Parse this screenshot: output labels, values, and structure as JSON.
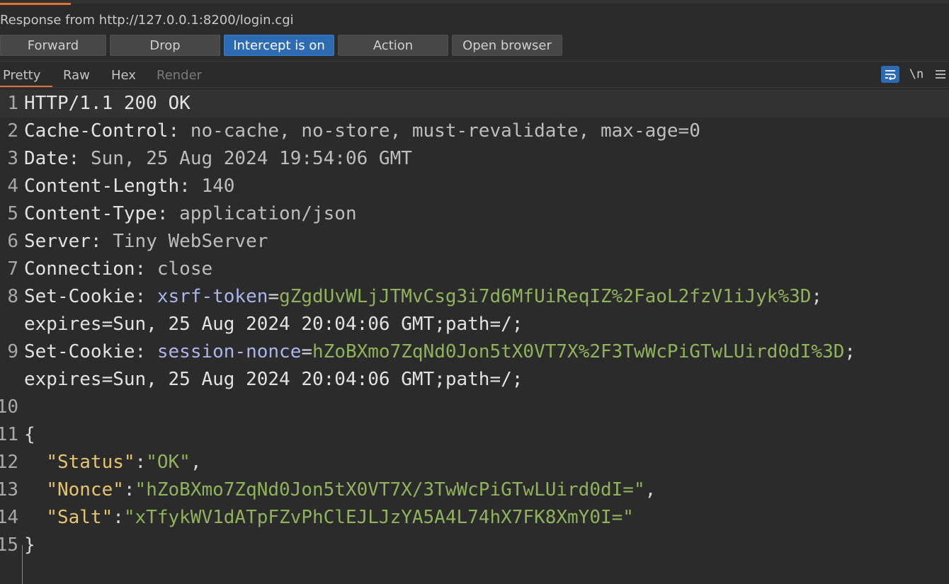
{
  "window": {
    "title": "Response from http://127.0.0.1:8200/login.cgi"
  },
  "toolbar": {
    "buttons": [
      {
        "label": "Forward",
        "active": false
      },
      {
        "label": "Drop",
        "active": false
      },
      {
        "label": "Intercept is on",
        "active": true
      },
      {
        "label": "Action",
        "active": false
      },
      {
        "label": "Open browser",
        "active": false
      }
    ]
  },
  "viewer": {
    "tabs": [
      {
        "label": "Pretty",
        "selected": true,
        "enabled": true
      },
      {
        "label": "Raw",
        "selected": false,
        "enabled": true
      },
      {
        "label": "Hex",
        "selected": false,
        "enabled": true
      },
      {
        "label": "Render",
        "selected": false,
        "enabled": false
      }
    ],
    "tools": {
      "wrap_icon": "wrap-lines-icon",
      "newline_label": "\\n",
      "menu_icon": "hamburger-menu-icon"
    }
  },
  "response": {
    "lines": [
      {
        "num": "1",
        "parts": [
          {
            "t": "HTTP/1.1 200 OK",
            "c": "hname"
          }
        ]
      },
      {
        "num": "2",
        "parts": [
          {
            "t": "Cache-Control",
            "c": "hname"
          },
          {
            "t": ": ",
            "c": "punct"
          },
          {
            "t": "no-cache, no-store, must-revalidate, max-age=0",
            "c": "hval"
          }
        ]
      },
      {
        "num": "3",
        "parts": [
          {
            "t": "Date",
            "c": "hname"
          },
          {
            "t": ": ",
            "c": "punct"
          },
          {
            "t": "Sun, 25 Aug 2024 19:54:06 GMT",
            "c": "hval"
          }
        ]
      },
      {
        "num": "4",
        "parts": [
          {
            "t": "Content-Length",
            "c": "hname"
          },
          {
            "t": ": ",
            "c": "punct"
          },
          {
            "t": "140",
            "c": "hval"
          }
        ]
      },
      {
        "num": "5",
        "parts": [
          {
            "t": "Content-Type",
            "c": "hname"
          },
          {
            "t": ": ",
            "c": "punct"
          },
          {
            "t": "application/json",
            "c": "hval"
          }
        ]
      },
      {
        "num": "6",
        "parts": [
          {
            "t": "Server",
            "c": "hname"
          },
          {
            "t": ": ",
            "c": "punct"
          },
          {
            "t": "Tiny WebServer",
            "c": "hval"
          }
        ]
      },
      {
        "num": "7",
        "parts": [
          {
            "t": "Connection",
            "c": "hname"
          },
          {
            "t": ": ",
            "c": "punct"
          },
          {
            "t": "close",
            "c": "hval"
          }
        ]
      },
      {
        "num": "8",
        "parts": [
          {
            "t": "Set-Cookie",
            "c": "hname"
          },
          {
            "t": ": ",
            "c": "punct"
          },
          {
            "t": "xsrf-token",
            "c": "ckname"
          },
          {
            "t": "=",
            "c": "punct"
          },
          {
            "t": "gZgdUvWLjJTMvCsg3i7d6MfUiReqIZ%2FaoL2fzV1iJyk%3D",
            "c": "ckval"
          },
          {
            "t": ";",
            "c": "punct"
          }
        ]
      },
      {
        "num": "",
        "parts": [
          {
            "t": "expires=Sun, 25 Aug 2024 20:04:06 GMT;path=/;",
            "c": "hname"
          }
        ]
      },
      {
        "num": "9",
        "parts": [
          {
            "t": "Set-Cookie",
            "c": "hname"
          },
          {
            "t": ": ",
            "c": "punct"
          },
          {
            "t": "session-nonce",
            "c": "ckname"
          },
          {
            "t": "=",
            "c": "punct"
          },
          {
            "t": "hZoBXmo7ZqNd0Jon5tX0VT7X%2F3TwWcPiGTwLUird0dI%3D",
            "c": "ckval"
          },
          {
            "t": ";",
            "c": "punct"
          }
        ]
      },
      {
        "num": "",
        "parts": [
          {
            "t": "expires=Sun, 25 Aug 2024 20:04:06 GMT;path=/;",
            "c": "hname"
          }
        ]
      },
      {
        "num": "10",
        "parts": []
      },
      {
        "num": "11",
        "parts": [
          {
            "t": "{",
            "c": "punct"
          }
        ]
      },
      {
        "num": "12",
        "parts": [
          {
            "t": "  ",
            "c": "punct"
          },
          {
            "t": "\"Status\"",
            "c": "jkey"
          },
          {
            "t": ":",
            "c": "punct"
          },
          {
            "t": "\"OK\"",
            "c": "jstr"
          },
          {
            "t": ",",
            "c": "punct"
          }
        ]
      },
      {
        "num": "13",
        "parts": [
          {
            "t": "  ",
            "c": "punct"
          },
          {
            "t": "\"Nonce\"",
            "c": "jkey"
          },
          {
            "t": ":",
            "c": "punct"
          },
          {
            "t": "\"hZoBXmo7ZqNd0Jon5tX0VT7X/3TwWcPiGTwLUird0dI=\"",
            "c": "jstr"
          },
          {
            "t": ",",
            "c": "punct"
          }
        ]
      },
      {
        "num": "14",
        "parts": [
          {
            "t": "  ",
            "c": "punct"
          },
          {
            "t": "\"Salt\"",
            "c": "jkey"
          },
          {
            "t": ":",
            "c": "punct"
          },
          {
            "t": "\"xTfykWV1dATpFZvPhClEJLJzYA5A4L74hX7FK8XmY0I=\"",
            "c": "jstr"
          }
        ]
      },
      {
        "num": "15",
        "parts": [
          {
            "t": "}",
            "c": "punct"
          }
        ]
      }
    ]
  },
  "colors": {
    "accent_orange": "#e2703a",
    "active_blue": "#2d6bb5",
    "background": "#2b2b2b"
  }
}
